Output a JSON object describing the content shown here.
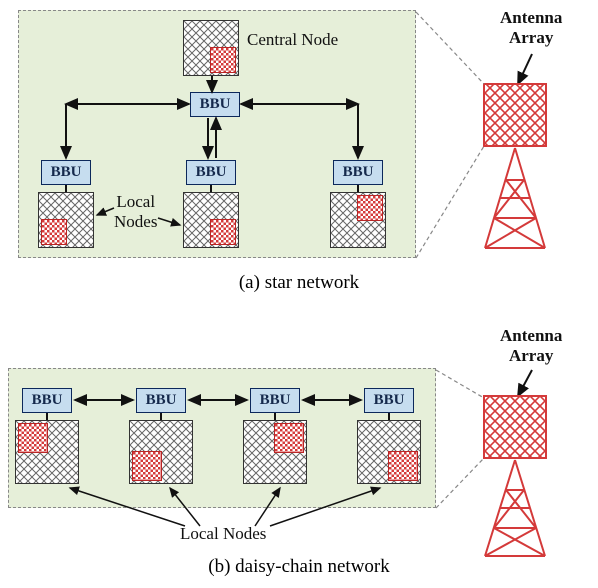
{
  "top": {
    "central_node": "Central Node",
    "local_nodes": "Local\nNodes",
    "bbu": "BBU",
    "caption": "(a) star network",
    "antenna": "Antenna\nArray"
  },
  "bot": {
    "bbu": "BBU",
    "local_nodes": "Local Nodes",
    "caption": "(b) daisy-chain network",
    "antenna": "Antenna\nArray"
  }
}
